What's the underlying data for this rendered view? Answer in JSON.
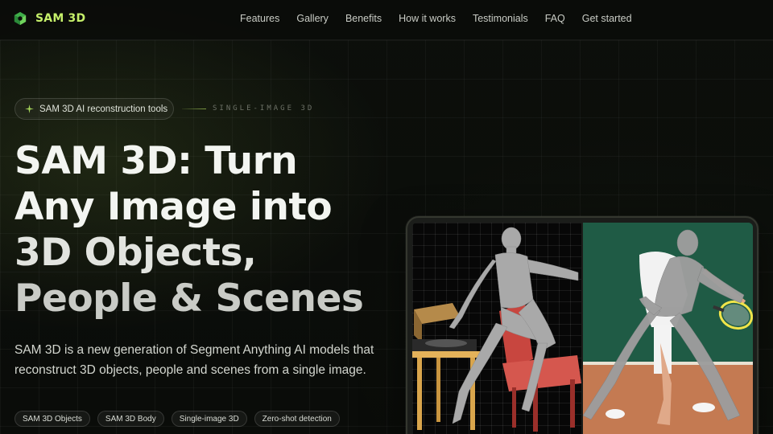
{
  "brand": {
    "name": "SAM 3D",
    "icon": "cube-logo-icon",
    "accent": "#c6f06a"
  },
  "nav": {
    "links": [
      {
        "label": "Features"
      },
      {
        "label": "Gallery"
      },
      {
        "label": "Benefits"
      },
      {
        "label": "How it works"
      },
      {
        "label": "Testimonials"
      },
      {
        "label": "FAQ"
      },
      {
        "label": "Get started"
      }
    ]
  },
  "hero": {
    "badge": {
      "text": "SAM 3D AI reconstruction tools",
      "icon": "sparkle-icon"
    },
    "tag": "SINGLE-IMAGE 3D",
    "headline": {
      "line1": "SAM 3D: Turn",
      "line2": "Any Image into",
      "line3": "3D Objects,",
      "line4": "People & Scenes"
    },
    "description": "SAM 3D is a new generation of Segment Anything AI models that reconstruct 3D objects, people and scenes from a single image.",
    "chips": [
      {
        "label": "SAM 3D Objects"
      },
      {
        "label": "SAM 3D Body"
      },
      {
        "label": "Single-image 3D"
      },
      {
        "label": "Zero-shot detection"
      }
    ]
  },
  "preview": {
    "left_panel": "3d-mesh-scene-render",
    "right_panel": "tennis-player-photo-with-mesh-overlay"
  }
}
